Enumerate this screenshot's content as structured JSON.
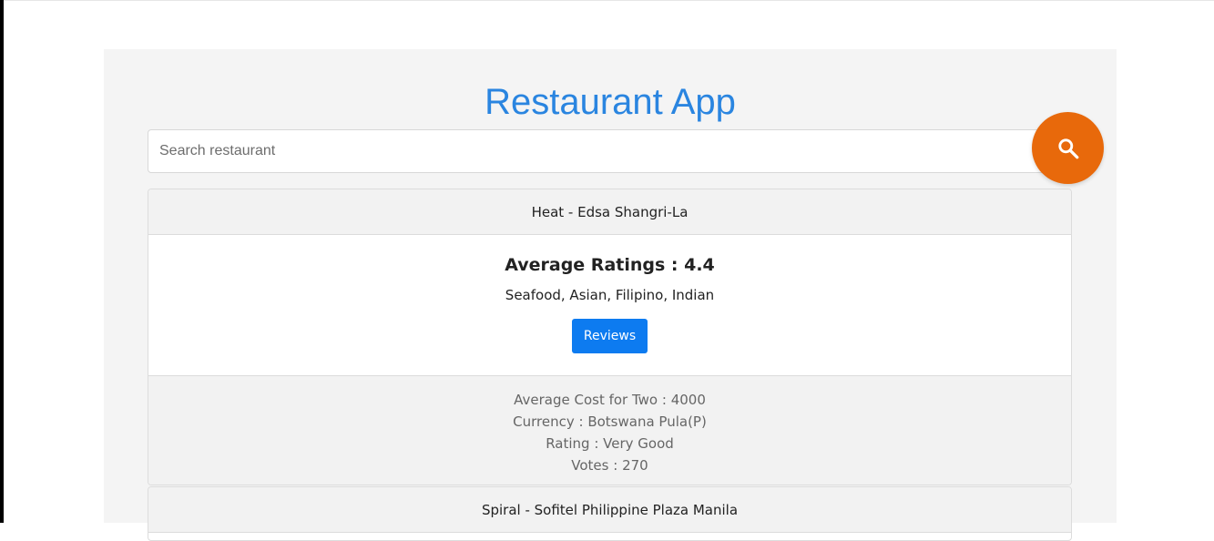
{
  "app": {
    "title": "Restaurant App"
  },
  "search": {
    "placeholder": "Search restaurant",
    "value": "",
    "button_icon": "search-icon",
    "button_color": "#e8690b"
  },
  "colors": {
    "title": "#2a85e0",
    "reviews_button": "#0d7bf0",
    "page_background": "#f4f4f4"
  },
  "restaurants": [
    {
      "name": "Heat - Edsa Shangri-La",
      "ratings_label": "Average Ratings : 4.4",
      "cuisines": "Seafood, Asian, Filipino, Indian",
      "reviews_label": "Reviews",
      "cost_for_two": "Average Cost for Two : 4000",
      "currency": "Currency : Botswana Pula(P)",
      "rating_text": "Rating : Very Good",
      "votes": "Votes : 270"
    },
    {
      "name": "Spiral - Sofitel Philippine Plaza Manila"
    }
  ]
}
